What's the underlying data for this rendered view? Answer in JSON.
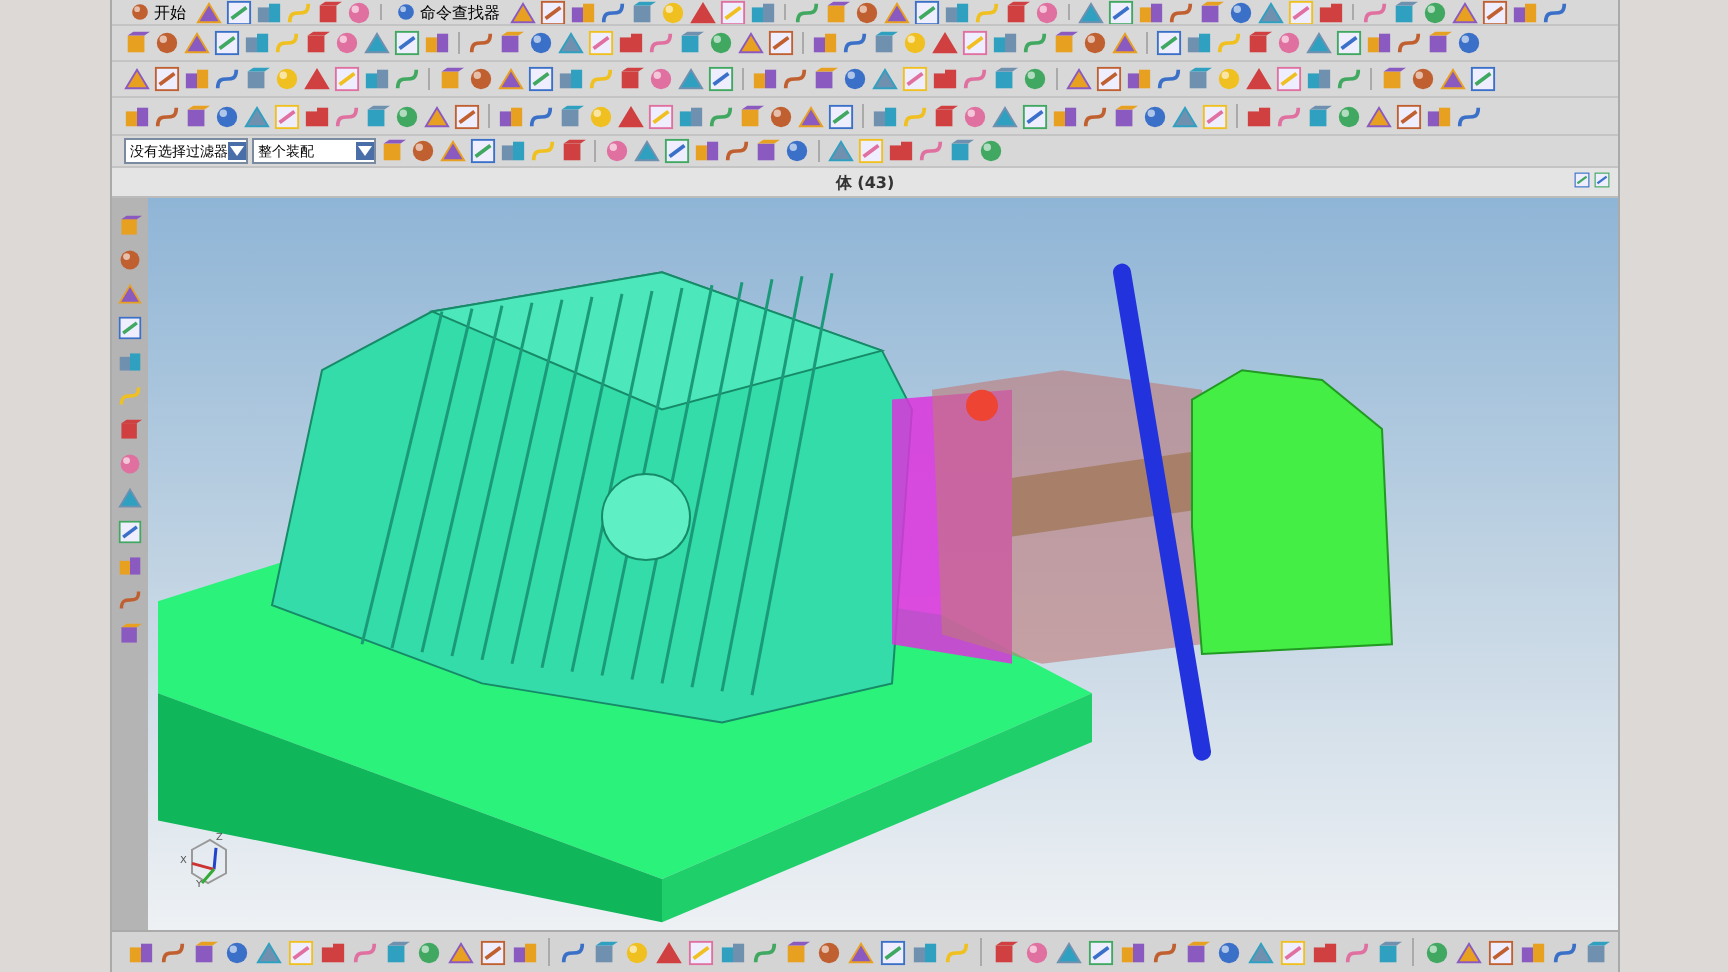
{
  "toolbar": {
    "start_menu": "开始",
    "command_finder": "命令查找器"
  },
  "selection_bar": {
    "filter": "没有选择过滤器",
    "scope": "整个装配"
  },
  "viewport": {
    "title": "体 (43)",
    "axes": [
      "X",
      "Y",
      "Z"
    ]
  }
}
